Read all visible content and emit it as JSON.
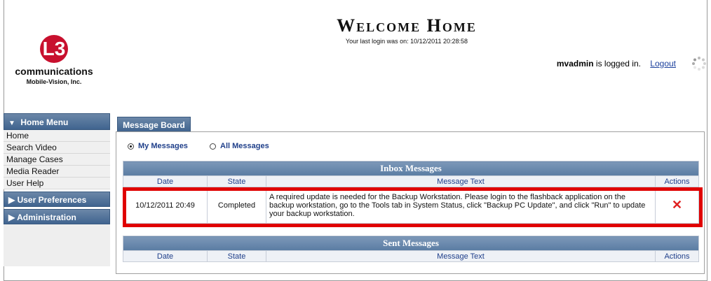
{
  "header": {
    "logo_mark": "L3",
    "logo_name": "communications",
    "logo_sub": "Mobile-Vision, Inc.",
    "welcome": "Welcome Home",
    "last_login": "Your last login was on: 10/12/2011 20:28:58",
    "username": "mvadmin",
    "logged_in_suffix": "is logged in.",
    "logout": "Logout"
  },
  "sidebar": {
    "home_menu": "Home Menu",
    "items": [
      {
        "label": "Home"
      },
      {
        "label": "Search Video"
      },
      {
        "label": "Manage Cases"
      },
      {
        "label": "Media Reader"
      },
      {
        "label": "User Help"
      }
    ],
    "user_prefs": "User Preferences",
    "administration": "Administration"
  },
  "message_board": {
    "tab": "Message Board",
    "radio_my": "My Messages",
    "radio_all": "All Messages",
    "selected": "My Messages",
    "inbox": {
      "title": "Inbox Messages",
      "headers": [
        "Date",
        "State",
        "Message Text",
        "Actions"
      ],
      "rows": [
        {
          "date": "10/12/2011 20:49",
          "state": "Completed",
          "text": "A required update is needed for the Backup Workstation. Please login to the flashback application on the backup workstation, go to the Tools tab in System Status, click \"Backup PC Update\", and click \"Run\" to update your backup workstation.",
          "action_icon": "delete-x-icon"
        }
      ]
    },
    "sent": {
      "title": "Sent Messages",
      "headers": [
        "Date",
        "State",
        "Message Text",
        "Actions"
      ]
    }
  },
  "colors": {
    "nav_blue": "#40648f",
    "header_blue": "#5a7ca3",
    "link_blue": "#1f3f8a",
    "highlight_red": "#e00000",
    "logo_red": "#c8102e"
  }
}
